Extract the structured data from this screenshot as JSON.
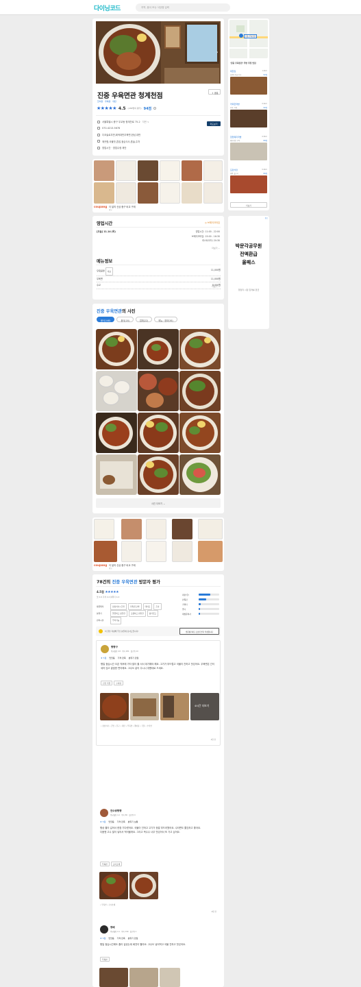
{
  "header": {
    "logo": "다이닝코드",
    "search_placeholder": "지역, 음식 또는 식당명 입력"
  },
  "restaurant": {
    "name": "진중 우육면관 청계천점",
    "categories": [
      "한식면",
      "우육면",
      "대만"
    ],
    "rating": "4.5",
    "rating_count": "(288명의 평가)",
    "score": "94점",
    "share_label": "공유"
  },
  "info": {
    "address": "서울특별시 중구 무교동 청계천로 75-2",
    "address_more": "지번 ∨",
    "phone": "070-4213-5678",
    "tags": "다코슬로우만,회색대만우육면,한남,대만",
    "keywords": "깨끗함,국물맛,혼밥,점심식사,혼술,주차",
    "hours_status": "영업시간 · 영업수정 제안",
    "map_button": "지도보기"
  },
  "coupang": {
    "brand": "coupang",
    "text": "이 달의 신상 중구 비교 구매",
    "sub": "광고"
  },
  "hours": {
    "title": "영업시간",
    "status": "브레이크타임",
    "today": "[오늘] 11.14 (목)",
    "rows": [
      "영업시간: 11:00 - 22:00",
      "브레이크타임: 15:00 - 16:30",
      "라스트오더: 20:30"
    ],
    "more": "더보기"
  },
  "menu": {
    "title": "메뉴정보",
    "items": [
      {
        "name": "우육탕면",
        "badge": "대표",
        "price": "11,000원"
      },
      {
        "name": "우육면",
        "price": "11,000원"
      },
      {
        "name": "수교",
        "price": "8,000원"
      }
    ],
    "more": "더보기"
  },
  "photos": {
    "title_brand": "진중 우육면관",
    "title_rest": "의 사진",
    "tabs": [
      "음식(148)",
      "음식(16)",
      "업체(22)",
      "메뉴 · 정보(36)"
    ],
    "more_button": "사진 더보기"
  },
  "reviews": {
    "count_title_pre": "78건의",
    "brand": "진중 우육면관",
    "count_title_post": "방문자 평가",
    "score": "4.5점",
    "sub": "맛 4.6  가격 4.2  분위기 4.4",
    "summary": [
      {
        "label": "대만(유)",
        "pct": 0.55
      },
      {
        "label": "만족감",
        "pct": 0.35
      },
      {
        "label": "가볍다",
        "pct": 0.1
      },
      {
        "label": "좋다",
        "pct": 0.05
      },
      {
        "label": "재방문의사",
        "pct": 0.05
      }
    ],
    "prompt": "이 글을 작성해 주신 분들께 감사드립니다!",
    "write_btn": "방문평가하고 포인트받기 작성합니다",
    "tags_rows": [
      {
        "label": "방문목적",
        "tags": [
          "점심식사+혼밥",
          "가족/친구와",
          "데이트",
          "혼술"
        ]
      },
      {
        "label": "분위기",
        "tags": [
          "깔끔하고 정갈한",
          "조용하고 편안한",
          "활기있고"
        ]
      },
      {
        "label": "편의시설",
        "tags": [
          "주차가능"
        ]
      }
    ]
  },
  "review_list": [
    {
      "author": "짱짱구",
      "meta": "평균별점 4.8 · 평가 281 · 팔로워 10",
      "rating": "5점",
      "badges": [
        "맛있음",
        "가격 만족",
        "분위기 만점"
      ],
      "text": "평일 점심시간 오픈 직후에 가자 많이 줄 서서 대기해야 해요. 고기가 부드럽고 국물이 진하고 맛있어요. 우육면은 간이 세지 않고 깔끔한 편이에요. 고수도 같이 주시니 취향대로 드세요.",
      "tags": [
        "진한 국물",
        "수타면"
      ],
      "more": "4시간 더보기",
      "date": "4일 전"
    },
    {
      "author": "연수랑짱짱",
      "meta": "평균별점 4.2 · 평가 86 · 팔로워 9",
      "rating": "5점",
      "badges": [
        "맛있음",
        "가격 만족",
        "분위기 보통"
      ],
      "text": "평상 줄이 길어서 한참 기다렸어요. 국물이 진하고 고기가 정말 부드러웠어요. 수타면도 쫄깃하고 좋아요. 다음엔 고수 많이 넣어서 먹어볼게요. 그리고 옥수수 너무 맛있어서 또 가고 싶어요.",
      "tags": [
        "우육면",
        "오이소채"
      ],
      "date": "6일 전"
    },
    {
      "author": "정배",
      "meta": "평균별점 4.1 · 평가 190 · 팔로워 1",
      "rating": "5점",
      "badges": [
        "맛있음",
        "가격 만족",
        "분위기 만점"
      ],
      "text": "평일 점심시간에도 줄이 길었는데 회전이 빨라요. 고수도 넣어먹고 국물 진하고 맛있어요.",
      "tags": [
        "우육면"
      ]
    }
  ],
  "sidebar": {
    "map_title": "진중 우육면관",
    "reco_title": "'진중 우육면관' 주변 추천 맛집",
    "items": [
      {
        "name": "대한집",
        "dist": "1.4km",
        "desc": "설렁탕 전골 진국",
        "score": "92점"
      },
      {
        "name": "커피한약방",
        "dist": "0.4km",
        "desc": "커피, 카페",
        "score": "90점"
      },
      {
        "name": "합천돼지국밥",
        "dist": "0.5km",
        "desc": "돼지국밥, 수육",
        "score": "89점"
      },
      {
        "name": "모란식당",
        "dist": "0.4km",
        "desc": "냉면, 불고기",
        "score": "89점"
      }
    ],
    "more": "더보기"
  },
  "ad": {
    "lines": [
      "박문각공무원",
      "전액환급",
      "올패스"
    ],
    "sub": "행정직 시험 합격률 환급",
    "ad_mark": "광고"
  },
  "colors": {
    "accent": "#2a7bd8",
    "brand": "#1fb9c9",
    "dark_button": "#143f6b"
  }
}
